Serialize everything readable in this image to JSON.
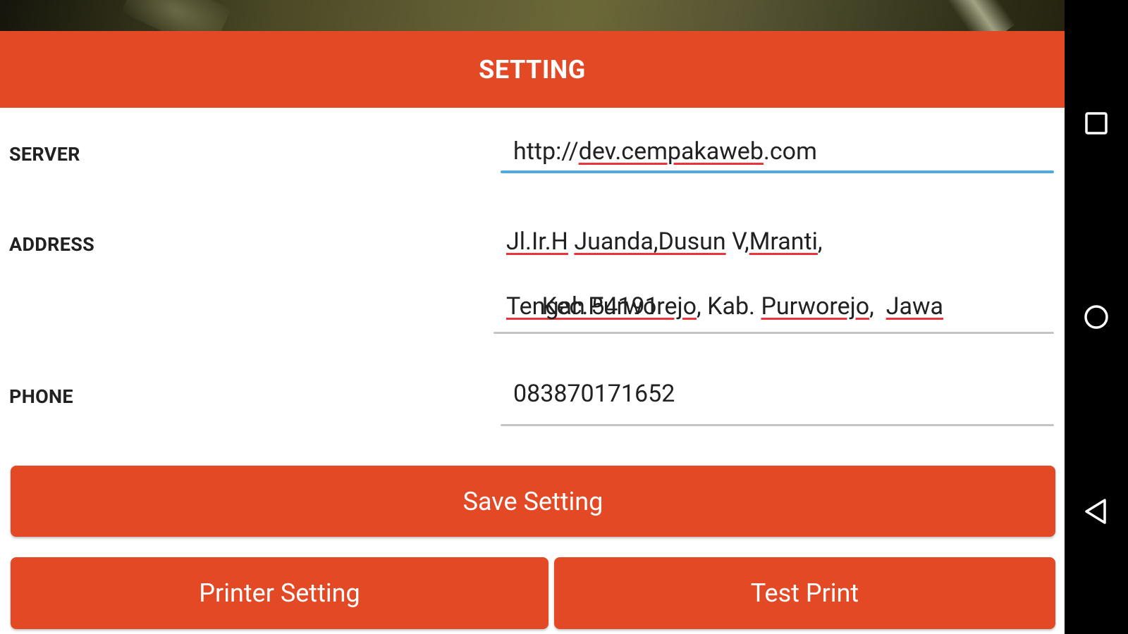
{
  "header": {
    "title": "SETTING"
  },
  "form": {
    "server": {
      "label": "SERVER",
      "value": "http://dev.cempakaweb.com"
    },
    "address": {
      "label": "ADDRESS",
      "lines": [
        [
          "Jl.Ir.H",
          " ",
          "Juanda,Dusun",
          " V,",
          "Mranti",
          ","
        ],
        [
          "Kec.Purworejo",
          ", Kab. ",
          "Purworejo",
          ",  ",
          "Jawa"
        ],
        [
          "Tengah",
          " 54191"
        ]
      ],
      "value": "Jl.Ir.H Juanda,Dusun V,Mranti, Kec.Purworejo, Kab. Purworejo,  Jawa Tengah 54191"
    },
    "phone": {
      "label": "PHONE",
      "value": "083870171652"
    }
  },
  "buttons": {
    "save": "Save Setting",
    "printer": "Printer Setting",
    "test": "Test Print"
  },
  "colors": {
    "accent": "#e44926",
    "focus_line": "#53a9de",
    "spell_underline": "#e8343a"
  },
  "navbar": {
    "icons": [
      "recents-square-icon",
      "home-circle-icon",
      "back-triangle-icon"
    ]
  }
}
